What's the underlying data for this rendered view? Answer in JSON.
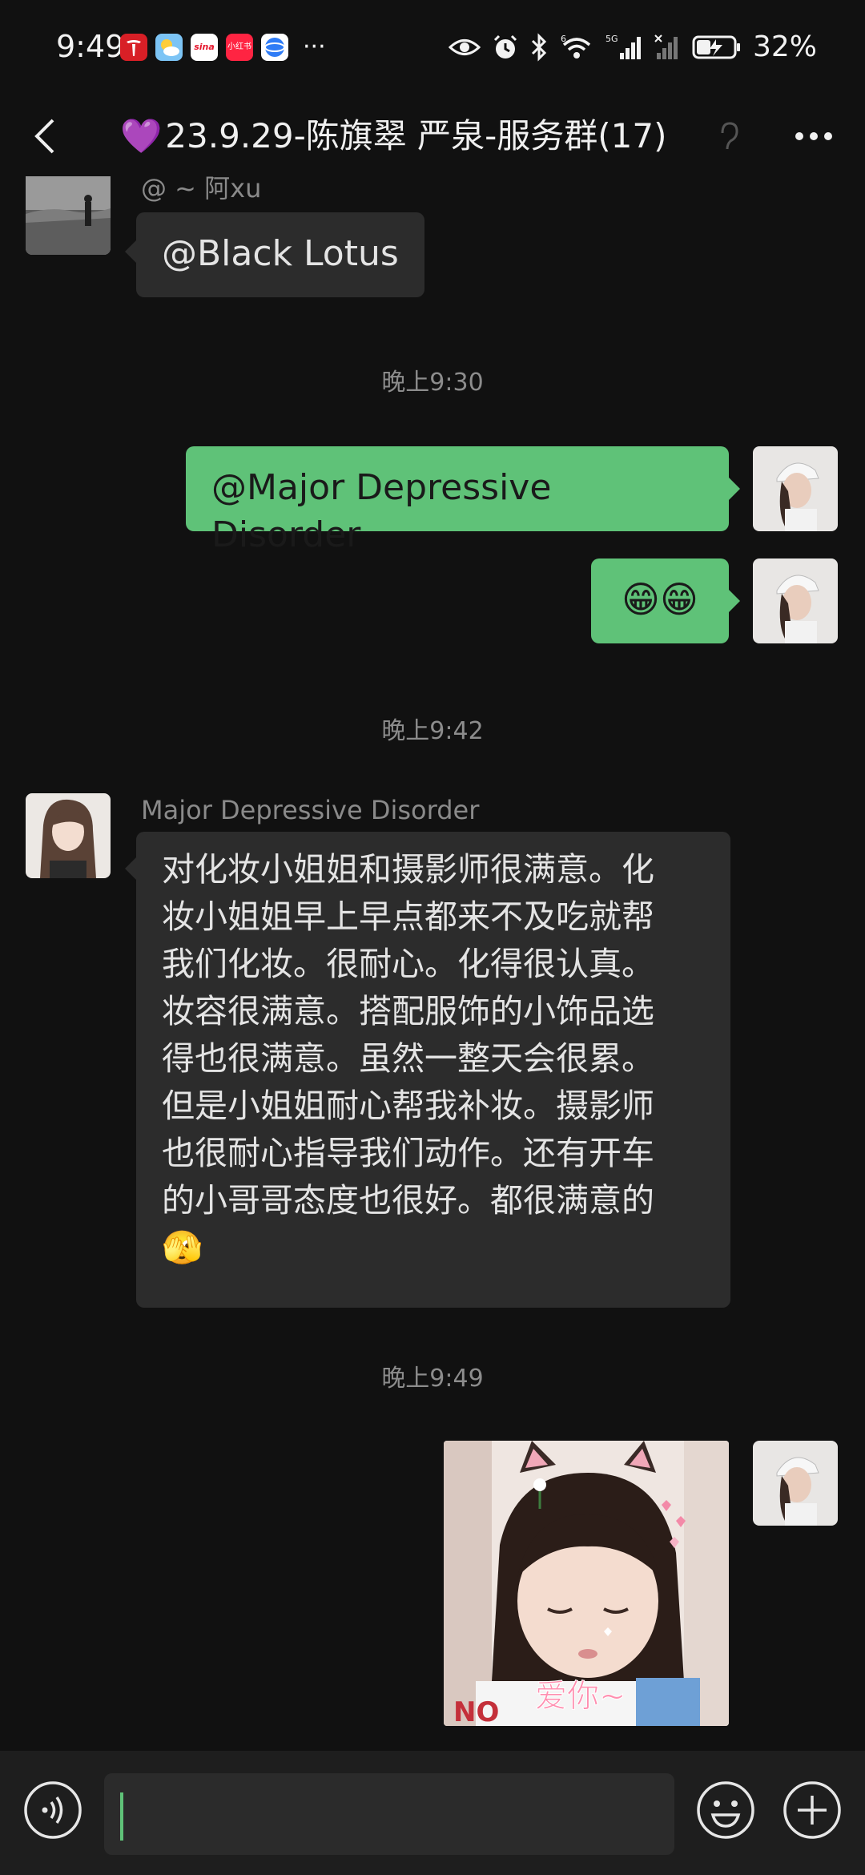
{
  "status_bar": {
    "time": "9:49",
    "notification_icons": [
      "tesla-icon",
      "weather-icon",
      "sina-icon",
      "xiaohongshu-icon",
      "browser-icon"
    ],
    "notif_labels": {
      "sina": "sina",
      "xiaohongshu": "小红书"
    },
    "more": "···",
    "battery": "32%"
  },
  "header": {
    "title_prefix": "💜",
    "title": "23.9.29-陈旗翠 严泉-服务群(17)"
  },
  "messages": [
    {
      "type": "incoming",
      "sender": "@ ~ 阿xu",
      "text": "@Black Lotus"
    },
    {
      "type": "timestamp",
      "text": "晚上9:30"
    },
    {
      "type": "outgoing",
      "text": "@Major Depressive Disorder"
    },
    {
      "type": "outgoing",
      "text": "😁😁"
    },
    {
      "type": "timestamp",
      "text": "晚上9:42"
    },
    {
      "type": "incoming",
      "sender": "Major Depressive Disorder",
      "lines": [
        "对化妆小姐姐和摄影师很满意。化",
        "妆小姐姐早上早点都来不及吃就帮",
        "我们化妆。很耐心。化得很认真。",
        "妆容很满意。搭配服饰的小饰品选",
        "得也很满意。虽然一整天会很累。",
        "但是小姐姐耐心帮我补妆。摄影师",
        "也很耐心指导我们动作。还有开车",
        "的小哥哥态度也很好。都很满意的",
        "🫣"
      ]
    },
    {
      "type": "timestamp",
      "text": "晚上9:49"
    },
    {
      "type": "outgoing-sticker",
      "caption": "爱你~"
    }
  ],
  "input": {
    "value": ""
  },
  "colors": {
    "background": "#111111",
    "bubble_outgoing": "#5fc278",
    "bubble_incoming": "#2c2c2c",
    "title_accent": "#a855f7"
  }
}
